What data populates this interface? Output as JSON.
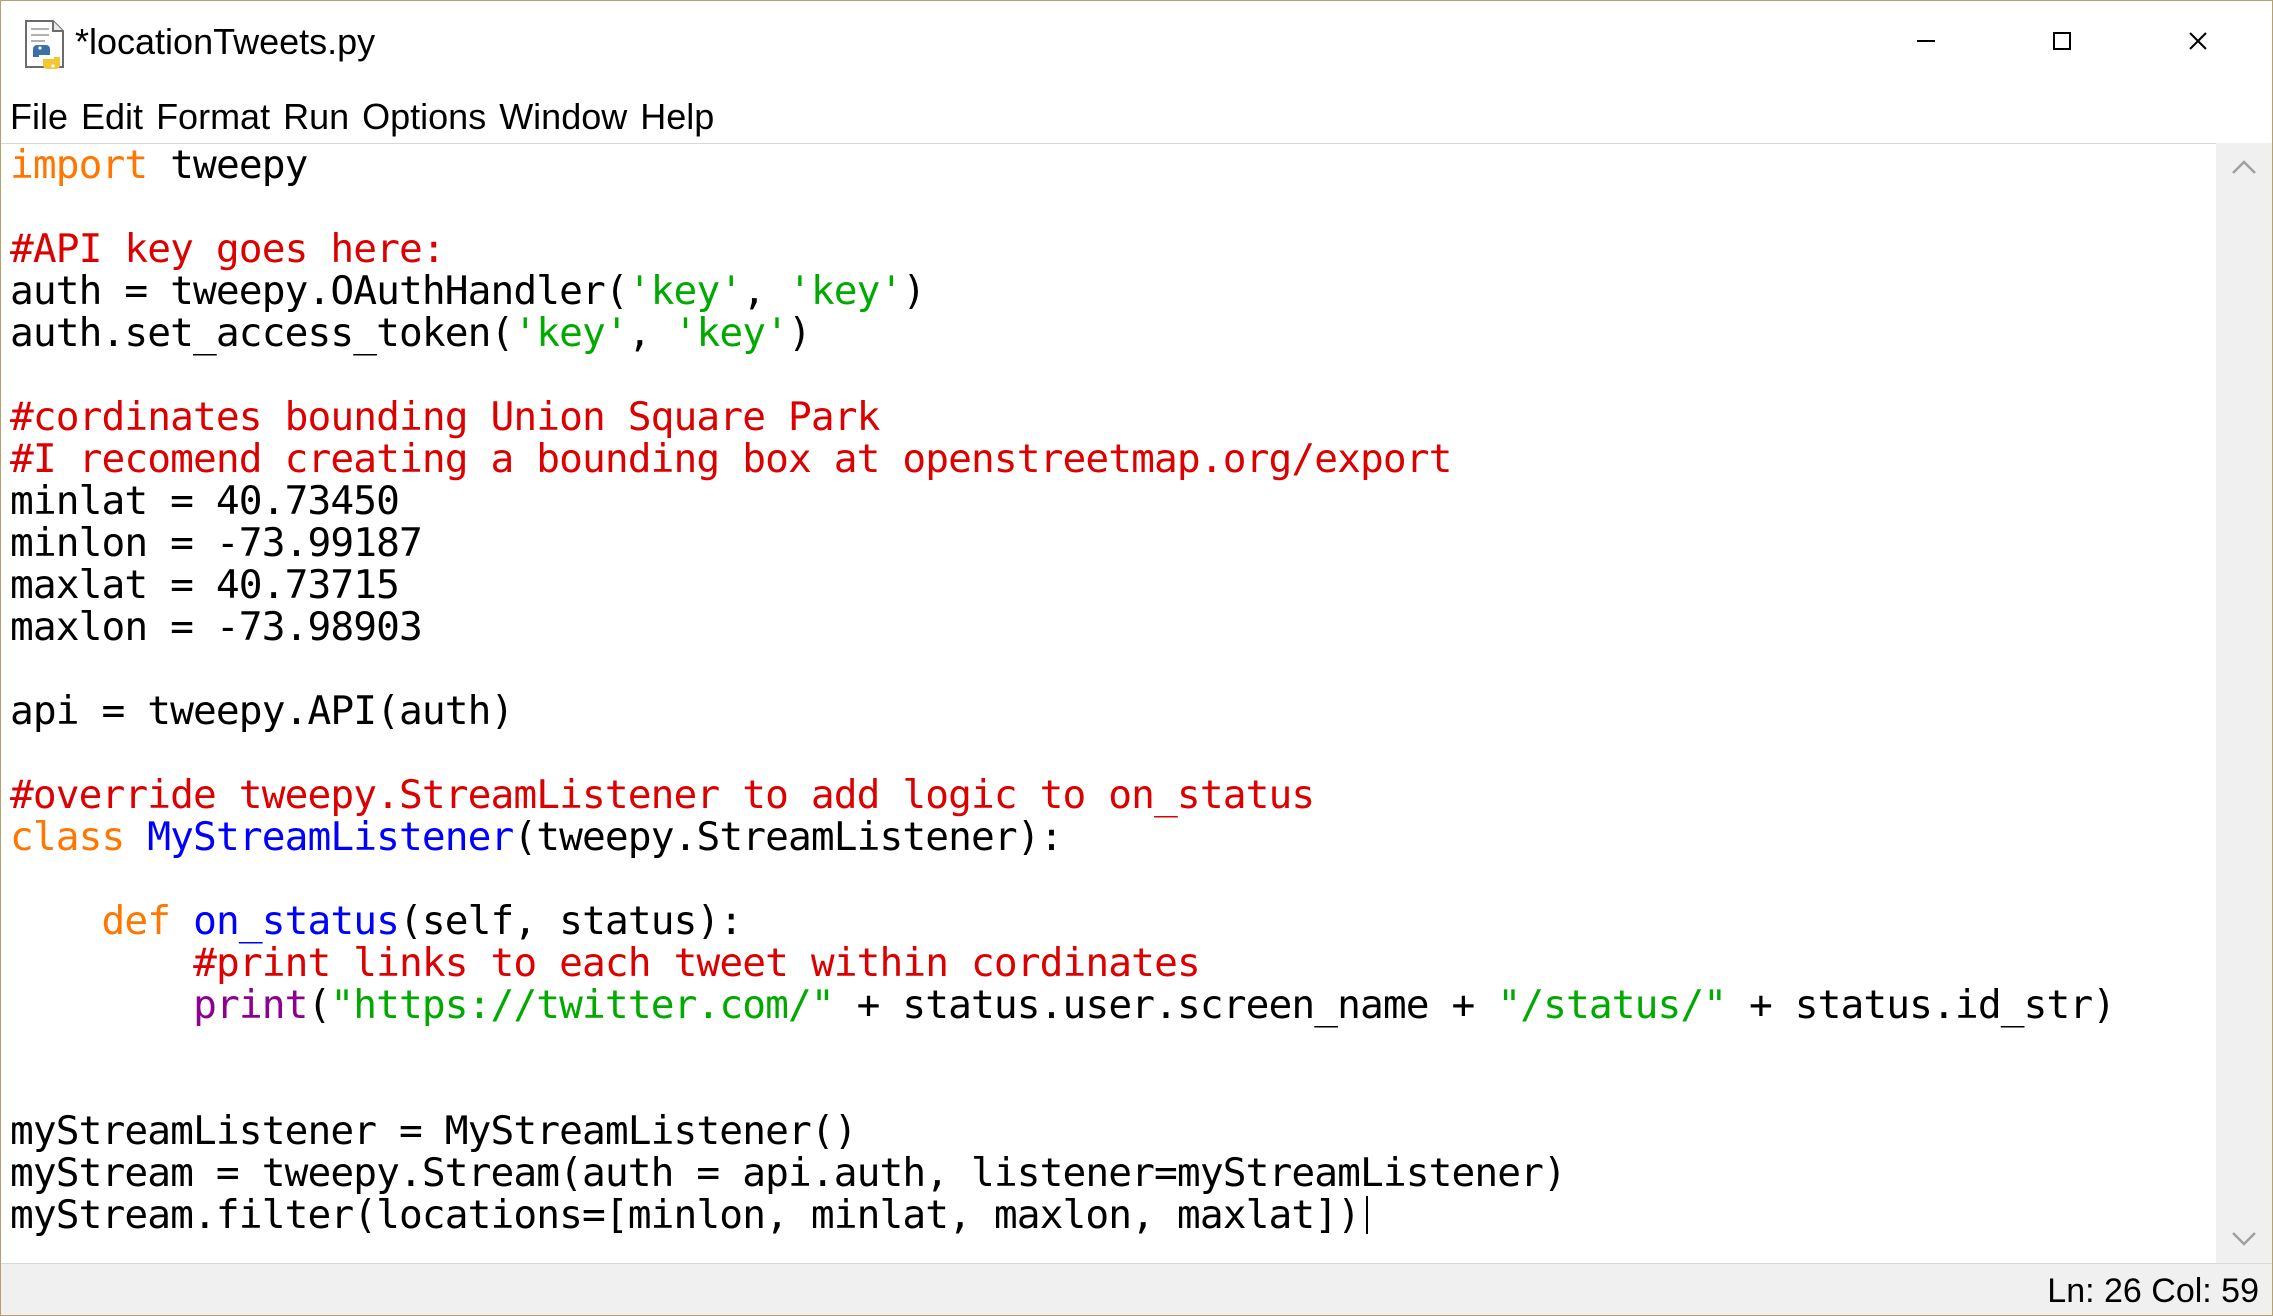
{
  "window": {
    "title": "*locationTweets.py",
    "icon": "python-file-icon",
    "controls": {
      "minimize_icon": "minimize-icon",
      "maximize_icon": "maximize-icon",
      "close_icon": "close-icon"
    }
  },
  "menu": {
    "items": [
      {
        "label": "File"
      },
      {
        "label": "Edit"
      },
      {
        "label": "Format"
      },
      {
        "label": "Run"
      },
      {
        "label": "Options"
      },
      {
        "label": "Window"
      },
      {
        "label": "Help"
      }
    ]
  },
  "editor": {
    "language": "python",
    "lines": [
      [
        {
          "t": "import",
          "c": "keyword"
        },
        {
          "t": " tweepy"
        }
      ],
      [],
      [
        {
          "t": "#API key goes here:",
          "c": "comment"
        }
      ],
      [
        {
          "t": "auth = tweepy.OAuthHandler("
        },
        {
          "t": "'key'",
          "c": "string"
        },
        {
          "t": ", "
        },
        {
          "t": "'key'",
          "c": "string"
        },
        {
          "t": ")"
        }
      ],
      [
        {
          "t": "auth.set_access_token("
        },
        {
          "t": "'key'",
          "c": "string"
        },
        {
          "t": ", "
        },
        {
          "t": "'key'",
          "c": "string"
        },
        {
          "t": ")"
        }
      ],
      [],
      [
        {
          "t": "#cordinates bounding Union Square Park",
          "c": "comment"
        }
      ],
      [
        {
          "t": "#I recomend creating a bounding box at openstreetmap.org/export",
          "c": "comment"
        }
      ],
      [
        {
          "t": "minlat = 40.73450"
        }
      ],
      [
        {
          "t": "minlon = -73.99187"
        }
      ],
      [
        {
          "t": "maxlat = 40.73715"
        }
      ],
      [
        {
          "t": "maxlon = -73.98903"
        }
      ],
      [],
      [
        {
          "t": "api = tweepy.API(auth)"
        }
      ],
      [],
      [
        {
          "t": "#override tweepy.StreamListener to add logic to on_status",
          "c": "comment"
        }
      ],
      [
        {
          "t": "class",
          "c": "keyword"
        },
        {
          "t": " "
        },
        {
          "t": "MyStreamListener",
          "c": "definition"
        },
        {
          "t": "(tweepy.StreamListener):"
        }
      ],
      [],
      [
        {
          "t": "    "
        },
        {
          "t": "def",
          "c": "keyword"
        },
        {
          "t": " "
        },
        {
          "t": "on_status",
          "c": "definition"
        },
        {
          "t": "(self, status):"
        }
      ],
      [
        {
          "t": "        "
        },
        {
          "t": "#print links to each tweet within cordinates",
          "c": "comment"
        }
      ],
      [
        {
          "t": "        "
        },
        {
          "t": "print",
          "c": "builtin"
        },
        {
          "t": "("
        },
        {
          "t": "\"https://twitter.com/\"",
          "c": "string"
        },
        {
          "t": " + status.user.screen_name + "
        },
        {
          "t": "\"/status/\"",
          "c": "string"
        },
        {
          "t": " + status.id_str)"
        }
      ],
      [],
      [],
      [
        {
          "t": "myStreamListener = MyStreamListener()"
        }
      ],
      [
        {
          "t": "myStream = tweepy.Stream(auth = api.auth, listener=myStreamListener)"
        }
      ],
      [
        {
          "t": "myStream.filter(locations=[minlon, minlat, maxlon, maxlat])"
        }
      ]
    ],
    "colors": {
      "keyword": "#ff7700",
      "comment": "#dd0000",
      "string": "#00aa00",
      "definition": "#0000ff",
      "builtin": "#900090",
      "default": "#000000"
    }
  },
  "scrollbar": {
    "up_icon": "scroll-up-arrow-icon",
    "down_icon": "scroll-down-arrow-icon"
  },
  "status": {
    "position": "Ln: 26 Col: 59"
  }
}
